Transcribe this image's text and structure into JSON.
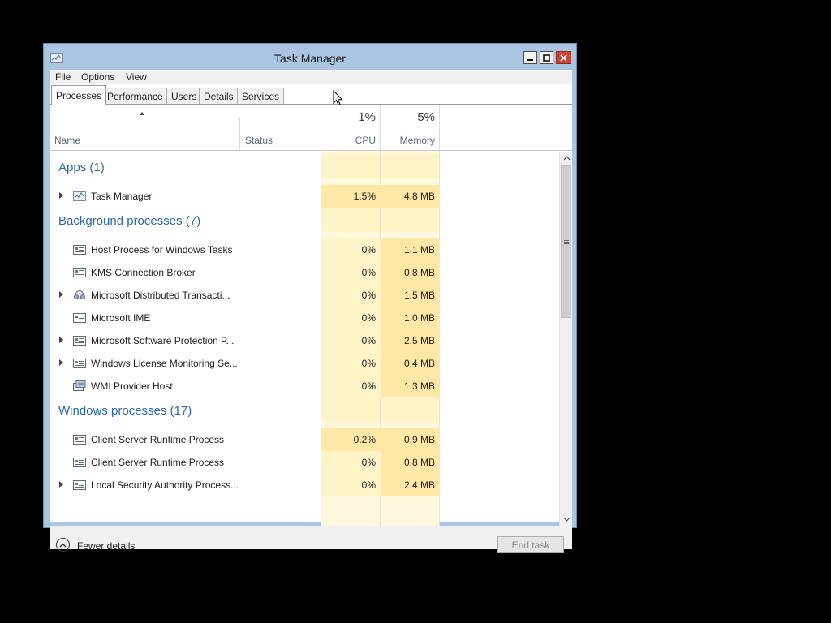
{
  "window": {
    "title": "Task Manager",
    "accent": "#a9c5e2",
    "close_color": "#c7463a"
  },
  "menu": [
    "File",
    "Options",
    "View"
  ],
  "tabs": [
    {
      "label": "Processes",
      "active": true
    },
    {
      "label": "Performance",
      "active": false
    },
    {
      "label": "Users",
      "active": false
    },
    {
      "label": "Details",
      "active": false
    },
    {
      "label": "Services",
      "active": false
    }
  ],
  "columns": {
    "name": "Name",
    "status": "Status",
    "cpu": {
      "label": "CPU",
      "total": "1%"
    },
    "memory": {
      "label": "Memory",
      "total": "5%"
    }
  },
  "groups": [
    {
      "title": "Apps (1)",
      "rows": [
        {
          "name": "Task Manager",
          "cpu": "1.5%",
          "memory": "4.8 MB",
          "expandable": true,
          "icon": "task-manager-icon"
        }
      ]
    },
    {
      "title": "Background processes (7)",
      "rows": [
        {
          "name": "Host Process for Windows Tasks",
          "cpu": "0%",
          "memory": "1.1 MB",
          "expandable": false,
          "icon": "process-window-icon"
        },
        {
          "name": "KMS Connection Broker",
          "cpu": "0%",
          "memory": "0.8 MB",
          "expandable": false,
          "icon": "process-window-icon"
        },
        {
          "name": "Microsoft Distributed Transacti...",
          "cpu": "0%",
          "memory": "1.5 MB",
          "expandable": true,
          "icon": "distributed-transaction-icon"
        },
        {
          "name": "Microsoft IME",
          "cpu": "0%",
          "memory": "1.0 MB",
          "expandable": false,
          "icon": "process-window-icon"
        },
        {
          "name": "Microsoft Software Protection P...",
          "cpu": "0%",
          "memory": "2.5 MB",
          "expandable": true,
          "icon": "process-window-icon"
        },
        {
          "name": "Windows License Monitoring Se...",
          "cpu": "0%",
          "memory": "0.4 MB",
          "expandable": true,
          "icon": "process-window-icon"
        },
        {
          "name": "WMI Provider Host",
          "cpu": "0%",
          "memory": "1.3 MB",
          "expandable": false,
          "icon": "wmi-provider-icon"
        }
      ]
    },
    {
      "title": "Windows processes (17)",
      "rows": [
        {
          "name": "Client Server Runtime Process",
          "cpu": "0.2%",
          "memory": "0.9 MB",
          "expandable": false,
          "icon": "process-window-icon"
        },
        {
          "name": "Client Server Runtime Process",
          "cpu": "0%",
          "memory": "0.8 MB",
          "expandable": false,
          "icon": "process-window-icon"
        },
        {
          "name": "Local Security Authority Process...",
          "cpu": "0%",
          "memory": "2.4 MB",
          "expandable": true,
          "icon": "process-window-icon"
        }
      ]
    }
  ],
  "footer": {
    "fewer_details": "Fewer details",
    "end_task": "End task",
    "end_task_enabled": false
  }
}
